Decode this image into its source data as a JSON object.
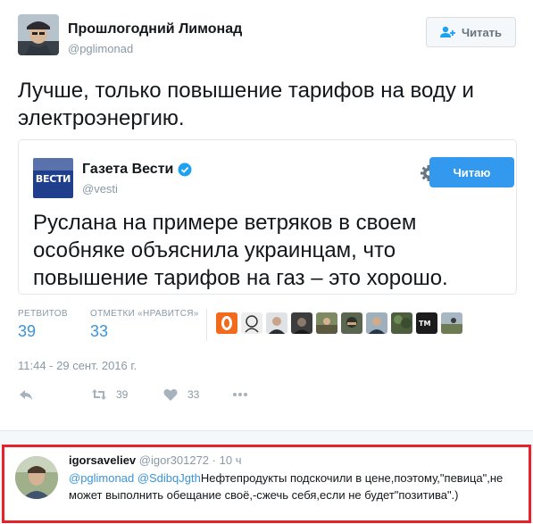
{
  "tweet": {
    "author_name": "Прошлогодний Лимонад",
    "author_handle": "@pglimonad",
    "follow_label": "Читать",
    "text": "Лучше, только повышение тарифов на воду и электроэнергию."
  },
  "quote": {
    "logo_text": "ВЕСТИ",
    "name": "Газета Вести",
    "handle": "@vesti",
    "button_label": "Читаю",
    "text": "Руслана на примере ветряков в своем особняке объяснила украинцам, что повышение тарифов на газ – это хорошо."
  },
  "stats": {
    "retweets_label": "РЕТВИТОВ",
    "retweets_value": "39",
    "likes_label": "ОТМЕТКИ «НРАВИТСЯ»",
    "likes_value": "33",
    "liker_avatars": [
      "orange-logo",
      "sketch",
      "portrait",
      "dark",
      "outdoor",
      "helmet",
      "portrait",
      "trees",
      "sign",
      "landscape"
    ]
  },
  "timestamp": "11:44 - 29 сент. 2016 г.",
  "actions": {
    "retweet_count": "39",
    "like_count": "33"
  },
  "reply": {
    "name": "igorsaveliev",
    "handle": "@igor301272",
    "separator": "·",
    "time": "10 ч",
    "mention1": "@pglimonad",
    "mention2": "@SdibqJgth",
    "text": "Нефтепродукты подскочили в цене,поэтому,\"певица\",не может выполнить обещание своё,-сжечь себя,если не будет\"позитива\".)"
  },
  "colors": {
    "accent": "#3b94d9",
    "follow_button": "#3399ee",
    "highlight_border": "#e8222a"
  }
}
